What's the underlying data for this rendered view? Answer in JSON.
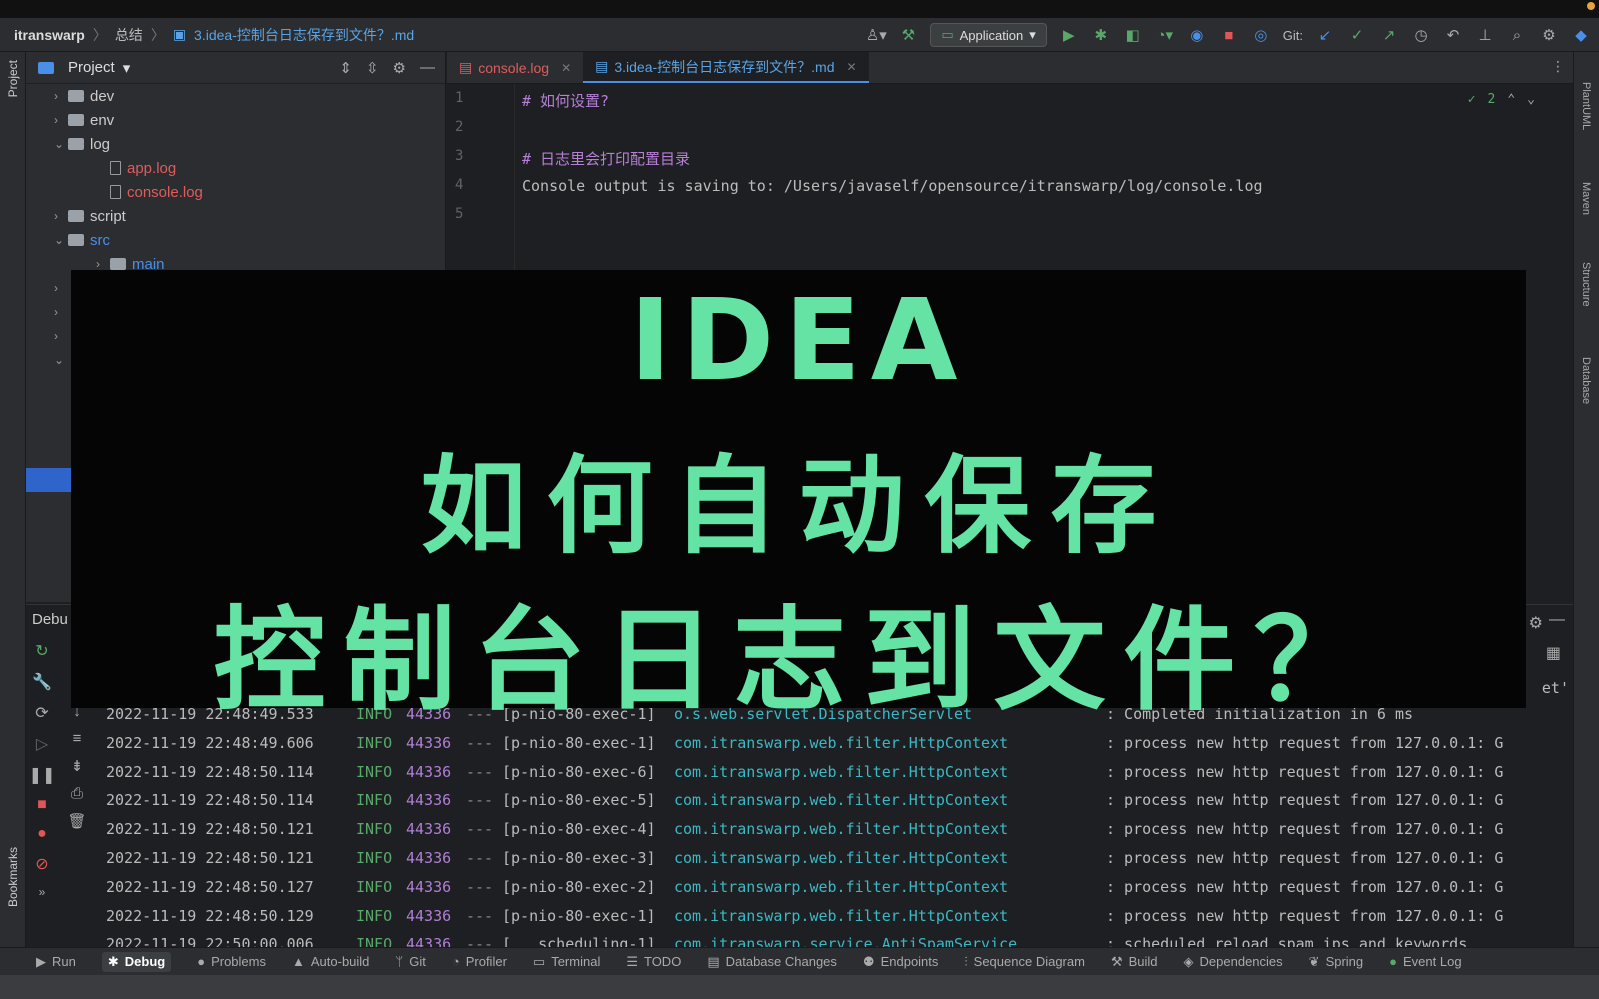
{
  "navbar": {
    "project": "itranswarp",
    "folder": "总结",
    "file": "3.idea-控制台日志保存到文件？.md",
    "run_config": "Application",
    "git_label": "Git:"
  },
  "left_strip": {
    "project_tab": "Project",
    "bookmarks_tab": "Bookmarks"
  },
  "right_strip": {
    "plantuml": "PlantUML",
    "maven": "Maven",
    "structure": "Structure",
    "database": "Database"
  },
  "project_panel": {
    "title": "Project",
    "tree": [
      {
        "label": "dev",
        "kind": "folder",
        "indent": 1,
        "expanded": false
      },
      {
        "label": "env",
        "kind": "folder",
        "indent": 1,
        "expanded": false
      },
      {
        "label": "log",
        "kind": "folder",
        "indent": 1,
        "expanded": true
      },
      {
        "label": "app.log",
        "kind": "file",
        "indent": 2,
        "color": "red"
      },
      {
        "label": "console.log",
        "kind": "file",
        "indent": 2,
        "color": "red"
      },
      {
        "label": "script",
        "kind": "folder",
        "indent": 1,
        "expanded": false
      },
      {
        "label": "src",
        "kind": "folder",
        "indent": 1,
        "expanded": true,
        "color": "blue"
      },
      {
        "label": "main",
        "kind": "folder",
        "indent": 2,
        "expanded": false,
        "color": "blue"
      }
    ]
  },
  "editor_tabs": [
    {
      "label": "console.log",
      "active": false
    },
    {
      "label": "3.idea-控制台日志保存到文件？.md",
      "active": true
    }
  ],
  "editor": {
    "inspection_count": "2",
    "lines": [
      {
        "no": "1",
        "text": "# 如何设置?",
        "comment": true
      },
      {
        "no": "2",
        "text": "",
        "comment": false
      },
      {
        "no": "3",
        "text": "# 日志里会打印配置目录",
        "comment": true
      },
      {
        "no": "4",
        "text": "Console output is saving to: /Users/javaself/opensource/itranswarp/log/console.log",
        "comment": false
      },
      {
        "no": "5",
        "text": "",
        "comment": false
      }
    ]
  },
  "debug": {
    "title": "Debu",
    "partial_right_text": "et'",
    "rows": [
      {
        "ts": "2022-11-19 22:48:49.533",
        "level": "INFO",
        "pid": "44336",
        "dash": "---",
        "thread": "[p-nio-80-exec-1]",
        "logger": "o.s.web.servlet.DispatcherServlet",
        "msg": ": Completed initialization in 6 ms"
      },
      {
        "ts": "2022-11-19 22:48:49.606",
        "level": "INFO",
        "pid": "44336",
        "dash": "---",
        "thread": "[p-nio-80-exec-1]",
        "logger": "com.itranswarp.web.filter.HttpContext",
        "msg": ": process new http request from 127.0.0.1: G"
      },
      {
        "ts": "2022-11-19 22:48:50.114",
        "level": "INFO",
        "pid": "44336",
        "dash": "---",
        "thread": "[p-nio-80-exec-6]",
        "logger": "com.itranswarp.web.filter.HttpContext",
        "msg": ": process new http request from 127.0.0.1: G"
      },
      {
        "ts": "2022-11-19 22:48:50.114",
        "level": "INFO",
        "pid": "44336",
        "dash": "---",
        "thread": "[p-nio-80-exec-5]",
        "logger": "com.itranswarp.web.filter.HttpContext",
        "msg": ": process new http request from 127.0.0.1: G"
      },
      {
        "ts": "2022-11-19 22:48:50.121",
        "level": "INFO",
        "pid": "44336",
        "dash": "---",
        "thread": "[p-nio-80-exec-4]",
        "logger": "com.itranswarp.web.filter.HttpContext",
        "msg": ": process new http request from 127.0.0.1: G"
      },
      {
        "ts": "2022-11-19 22:48:50.121",
        "level": "INFO",
        "pid": "44336",
        "dash": "---",
        "thread": "[p-nio-80-exec-3]",
        "logger": "com.itranswarp.web.filter.HttpContext",
        "msg": ": process new http request from 127.0.0.1: G"
      },
      {
        "ts": "2022-11-19 22:48:50.127",
        "level": "INFO",
        "pid": "44336",
        "dash": "---",
        "thread": "[p-nio-80-exec-2]",
        "logger": "com.itranswarp.web.filter.HttpContext",
        "msg": ": process new http request from 127.0.0.1: G"
      },
      {
        "ts": "2022-11-19 22:48:50.129",
        "level": "INFO",
        "pid": "44336",
        "dash": "---",
        "thread": "[p-nio-80-exec-1]",
        "logger": "com.itranswarp.web.filter.HttpContext",
        "msg": ": process new http request from 127.0.0.1: G"
      },
      {
        "ts": "2022-11-19 22:50:00.006",
        "level": "INFO",
        "pid": "44336",
        "dash": "---",
        "thread": "[   scheduling-1]",
        "logger": "com.itranswarp.service.AntiSpamService",
        "msg": ": scheduled reload spam ips and keywords"
      }
    ]
  },
  "status_bar": [
    {
      "label": "Run",
      "icon": "run-icon",
      "active": false
    },
    {
      "label": "Debug",
      "icon": "debug-icon",
      "active": true
    },
    {
      "label": "Problems",
      "icon": "problems-icon",
      "active": false
    },
    {
      "label": "Auto-build",
      "icon": "auto-build-icon",
      "active": false
    },
    {
      "label": "Git",
      "icon": "git-icon",
      "active": false
    },
    {
      "label": "Profiler",
      "icon": "profiler-icon",
      "active": false
    },
    {
      "label": "Terminal",
      "icon": "terminal-icon",
      "active": false
    },
    {
      "label": "TODO",
      "icon": "todo-icon",
      "active": false
    },
    {
      "label": "Database Changes",
      "icon": "database-icon",
      "active": false
    },
    {
      "label": "Endpoints",
      "icon": "endpoints-icon",
      "active": false
    },
    {
      "label": "Sequence Diagram",
      "icon": "sequence-icon",
      "active": false
    },
    {
      "label": "Build",
      "icon": "build-icon",
      "active": false
    },
    {
      "label": "Dependencies",
      "icon": "dependencies-icon",
      "active": false
    },
    {
      "label": "Spring",
      "icon": "spring-icon",
      "active": false
    },
    {
      "label": "Event Log",
      "icon": "event-log-icon",
      "active": false
    }
  ],
  "overlay": {
    "line1": "IDEA",
    "line2": "如何自动保存",
    "line3": "控制台日志到文件？"
  },
  "colors": {
    "overlay_text": "#64e3a4",
    "accent_blue": "#4a8fe7",
    "vcs_red": "#e05c5c",
    "log_level": "#59a869",
    "logger_cyan": "#3ab8c4"
  }
}
